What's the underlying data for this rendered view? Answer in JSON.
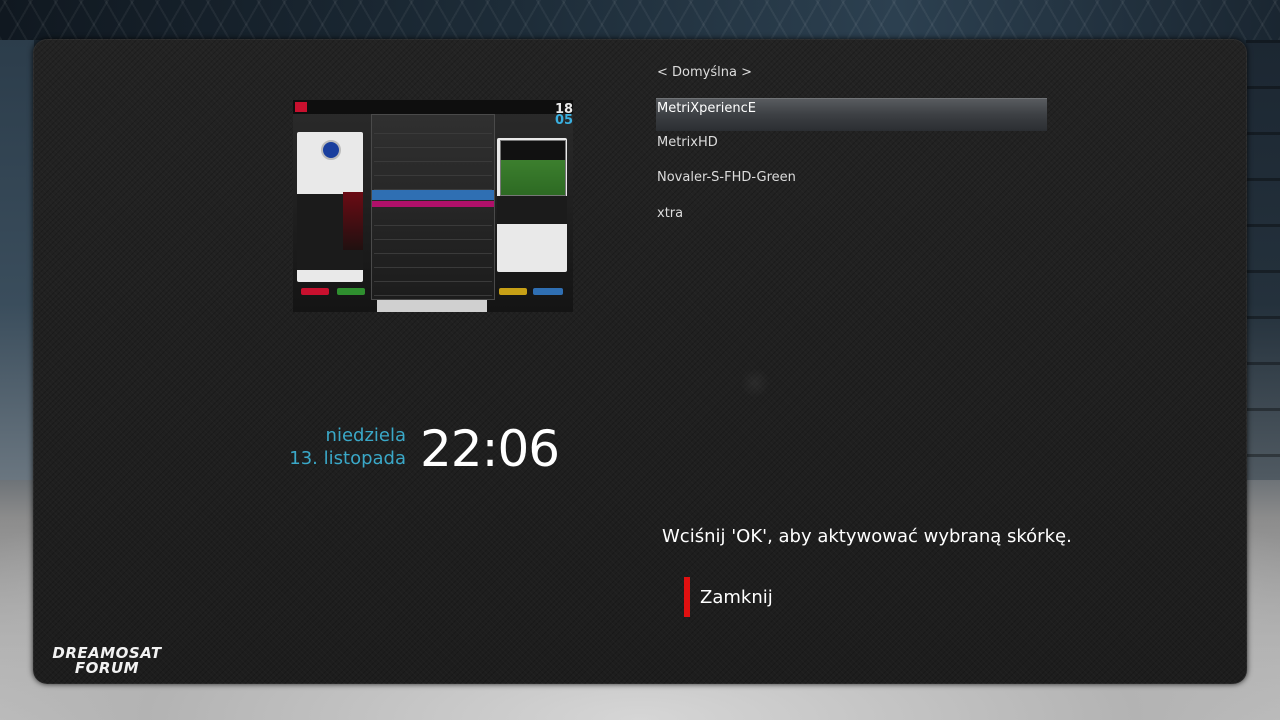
{
  "skins": {
    "items": [
      {
        "label": "< Domyślna >",
        "selected": false
      },
      {
        "label": "MetriXperiencE",
        "selected": true
      },
      {
        "label": "MetrixHD",
        "selected": false
      },
      {
        "label": "Novaler-S-FHD-Green",
        "selected": false
      },
      {
        "label": "xtra",
        "selected": false
      }
    ]
  },
  "datetime": {
    "day": "niedziela",
    "date": "13. listopada",
    "time": "22:06"
  },
  "preview": {
    "clock_hours": "18",
    "clock_minutes": "05"
  },
  "hint": "Wciśnij 'OK', aby aktywować wybraną skórkę.",
  "close_button": {
    "label": "Zamknij",
    "accent": "#e01010"
  },
  "logo": {
    "line1": "DREAMOSAT",
    "line2": "FORUM"
  },
  "colors": {
    "date": "#3aa8c8",
    "selection": "#4a4d51"
  }
}
